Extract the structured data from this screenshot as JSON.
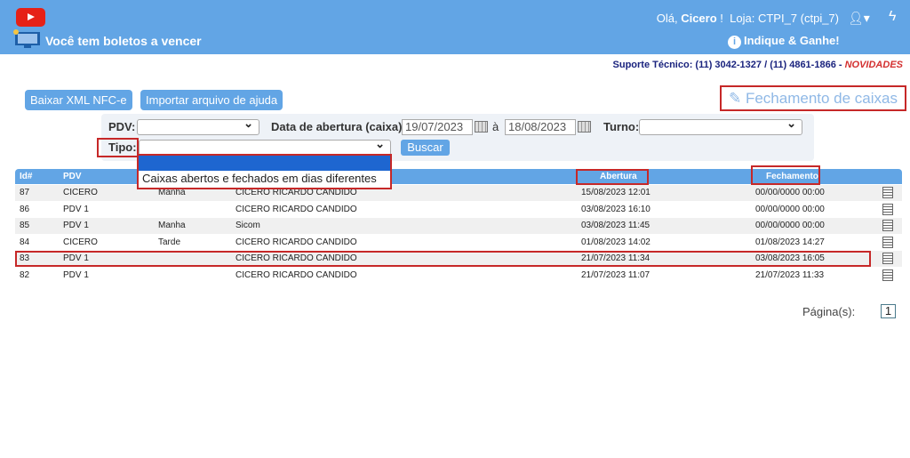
{
  "header": {
    "notice": "Você tem boletos a vencer",
    "greeting": "Olá,",
    "user": "Cicero",
    "greeting_end": "!",
    "store": "Loja: CTPI_7 (ctpi_7)",
    "refer": "Indique & Ganhe!"
  },
  "support": {
    "text": "Suporte Técnico: (11) 3042-1327 / (11) 4861-1866 - ",
    "news": "NOVIDADES"
  },
  "buttons": {
    "xml": "Baixar XML NFC-e",
    "import": "Importar arquivo de ajuda",
    "closing": "Fechamento de caixas"
  },
  "filters": {
    "pdv_label": "PDV:",
    "date_label": "Data de abertura (caixa):",
    "date_from": "19/07/2023",
    "date_sep": "à",
    "date_to": "18/08/2023",
    "turno_label": "Turno:",
    "tipo_label": "Tipo:",
    "search": "Buscar",
    "tipo_options": [
      "",
      "Caixas abertos e fechados em dias diferentes"
    ]
  },
  "table": {
    "headers": [
      "Id#",
      "PDV",
      "",
      "",
      "Abertura",
      "Fechamento"
    ],
    "rows": [
      [
        "87",
        "CICERO",
        "Manha",
        "CICERO RICARDO CANDIDO",
        "15/08/2023 12:01",
        "00/00/0000 00:00"
      ],
      [
        "86",
        "PDV 1",
        "",
        "CICERO RICARDO CANDIDO",
        "03/08/2023 16:10",
        "00/00/0000 00:00"
      ],
      [
        "85",
        "PDV 1",
        "Manha",
        "Sicom",
        "03/08/2023 11:45",
        "00/00/0000 00:00"
      ],
      [
        "84",
        "CICERO",
        "Tarde",
        "CICERO RICARDO CANDIDO",
        "01/08/2023 14:02",
        "01/08/2023 14:27"
      ],
      [
        "83",
        "PDV 1",
        "",
        "CICERO RICARDO CANDIDO",
        "21/07/2023 11:34",
        "03/08/2023 16:05"
      ],
      [
        "82",
        "PDV 1",
        "",
        "CICERO RICARDO CANDIDO",
        "21/07/2023 11:07",
        "21/07/2023 11:33"
      ]
    ]
  },
  "pagination": {
    "label": "Página(s):",
    "page": "1"
  },
  "colors": {
    "accent": "#62a5e5",
    "highlight": "#c62828"
  }
}
